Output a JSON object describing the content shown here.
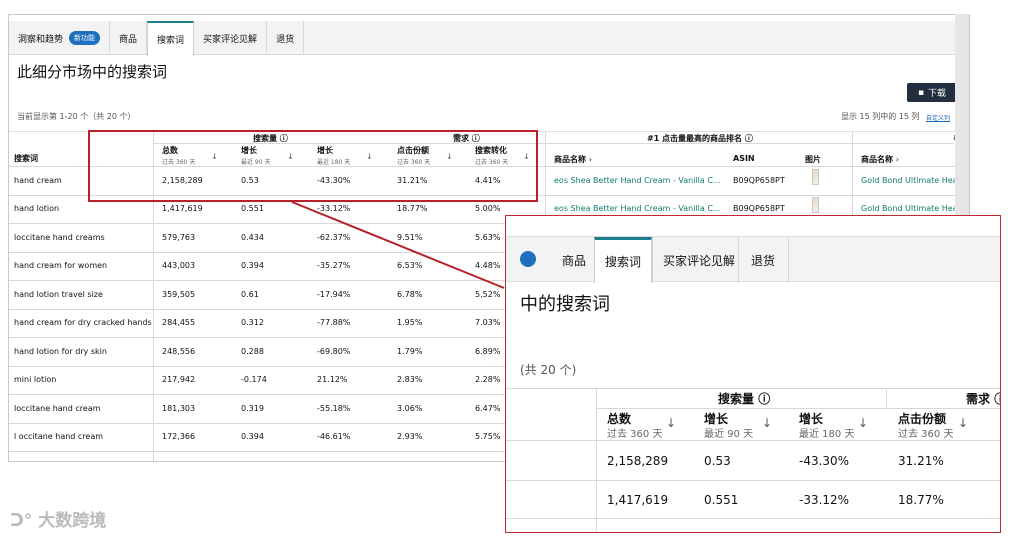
{
  "tabs": {
    "t1": "洞察和趋势",
    "badge": "新功能",
    "t2": "商品",
    "t3": "搜索词",
    "t4": "买家评论见解",
    "t5": "退货"
  },
  "title": "此细分市场中的搜索词",
  "download": "下载",
  "count_text": "当前显示第 1-20 个（共 20 个）",
  "col_count_text": "显示 15 列中的 15 列",
  "customize": "自定义列",
  "headers": {
    "search_volume": "搜索量",
    "demand": "需求",
    "top_product": "#1 点击量最高的商品排名",
    "search_term": "搜索词",
    "total": "总数",
    "past360": "过去 360 天",
    "growth": "增长",
    "recent90": "最近 90 天",
    "recent180": "最近 180 天",
    "click_share": "点击份额",
    "conversion": "搜索转化",
    "product_name": "商品名称",
    "asin": "ASIN",
    "image": "图片",
    "hash": "#"
  },
  "rows": [
    {
      "term": "hand cream",
      "total": "2,158,289",
      "g90": "0.53",
      "g180": "-43.30%",
      "share": "31.21%",
      "conv": "4.41%",
      "product": "eos Shea Better Hand Cream - Vanilla C...",
      "asin": "B09QP658PT",
      "product2": "Gold Bond Ultimate Hea"
    },
    {
      "term": "hand lotion",
      "total": "1,417,619",
      "g90": "0.551",
      "g180": "-33.12%",
      "share": "18.77%",
      "conv": "5.00%",
      "product": "eos Shea Better Hand Cream - Vanilla C...",
      "asin": "B09QP658PT",
      "product2": "Gold Bond Ultimate Hea"
    },
    {
      "term": "loccitane hand creams",
      "total": "579,763",
      "g90": "0.434",
      "g180": "-62.37%",
      "share": "9.51%",
      "conv": "5.63%"
    },
    {
      "term": "hand cream for women",
      "total": "443,003",
      "g90": "0.394",
      "g180": "-35.27%",
      "share": "6.53%",
      "conv": "4.48%"
    },
    {
      "term": "hand lotion travel size",
      "total": "359,505",
      "g90": "0.61",
      "g180": "-17.94%",
      "share": "6.78%",
      "conv": "5.52%"
    },
    {
      "term": "hand cream for dry cracked hands",
      "total": "284,455",
      "g90": "0.312",
      "g180": "-77.88%",
      "share": "1.95%",
      "conv": "7.03%"
    },
    {
      "term": "hand lotion for dry skin",
      "total": "248,556",
      "g90": "0.288",
      "g180": "-69.80%",
      "share": "1.79%",
      "conv": "6.89%"
    },
    {
      "term": "mini lotion",
      "total": "217,942",
      "g90": "-0.174",
      "g180": "21.12%",
      "share": "2.83%",
      "conv": "2.28%"
    },
    {
      "term": "loccitane hand cream",
      "total": "181,303",
      "g90": "0.319",
      "g180": "-55.18%",
      "share": "3.06%",
      "conv": "6.47%"
    },
    {
      "term": "l occitane hand cream",
      "total": "172,366",
      "g90": "0.394",
      "g180": "-46.61%",
      "share": "2.93%",
      "conv": "5.75%"
    }
  ],
  "callout": {
    "c_title": "中的搜索词",
    "c_count": "(共 20 个)"
  },
  "watermark": "大数跨境"
}
